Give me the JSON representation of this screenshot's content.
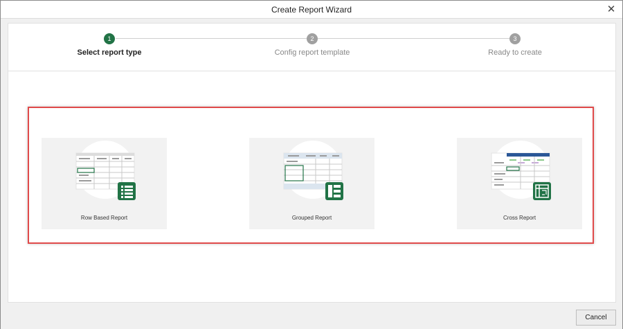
{
  "window": {
    "title": "Create Report Wizard",
    "close_glyph": "✕"
  },
  "steps": [
    {
      "number": "1",
      "label": "Select report type",
      "active": true
    },
    {
      "number": "2",
      "label": "Config report template",
      "active": false
    },
    {
      "number": "3",
      "label": "Ready to create",
      "active": false
    }
  ],
  "report_types": [
    {
      "label": "Row Based Report",
      "icon": "row-based-report-icon"
    },
    {
      "label": "Grouped Report",
      "icon": "grouped-report-icon"
    },
    {
      "label": "Cross Report",
      "icon": "cross-report-icon"
    }
  ],
  "footer": {
    "cancel_label": "Cancel"
  },
  "colors": {
    "accent": "#217346",
    "highlight": "#e04a4a",
    "cross_header": "#2b5797"
  }
}
